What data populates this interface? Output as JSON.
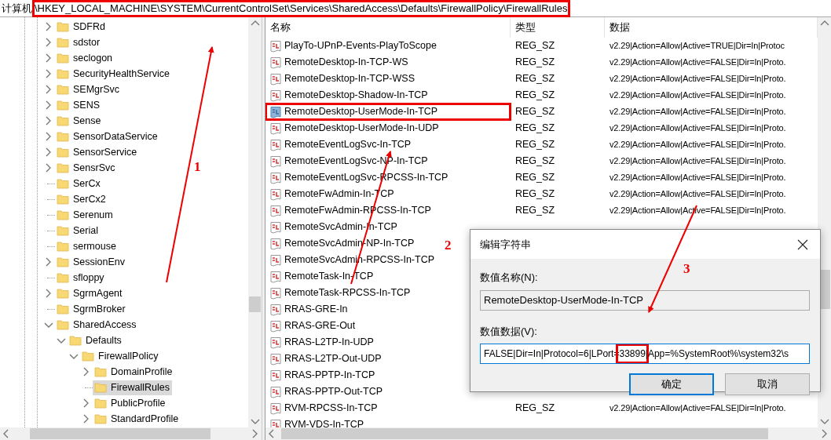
{
  "address_bar": {
    "label": "计算机",
    "path": "\\HKEY_LOCAL_MACHINE\\SYSTEM\\CurrentControlSet\\Services\\SharedAccess\\Defaults\\FirewallPolicy\\FirewallRules",
    "highlighted": true
  },
  "tree": {
    "items": [
      {
        "label": "SDFRd",
        "expandable": true,
        "expanded": false,
        "selected": false
      },
      {
        "label": "sdstor",
        "expandable": true,
        "expanded": false,
        "selected": false
      },
      {
        "label": "seclogon",
        "expandable": true,
        "expanded": false,
        "selected": false
      },
      {
        "label": "SecurityHealthService",
        "expandable": true,
        "expanded": false,
        "selected": false
      },
      {
        "label": "SEMgrSvc",
        "expandable": true,
        "expanded": false,
        "selected": false
      },
      {
        "label": "SENS",
        "expandable": true,
        "expanded": false,
        "selected": false
      },
      {
        "label": "Sense",
        "expandable": true,
        "expanded": false,
        "selected": false
      },
      {
        "label": "SensorDataService",
        "expandable": true,
        "expanded": false,
        "selected": false
      },
      {
        "label": "SensorService",
        "expandable": true,
        "expanded": false,
        "selected": false
      },
      {
        "label": "SensrSvc",
        "expandable": true,
        "expanded": false,
        "selected": false
      },
      {
        "label": "SerCx",
        "expandable": false,
        "selected": false
      },
      {
        "label": "SerCx2",
        "expandable": false,
        "selected": false
      },
      {
        "label": "Serenum",
        "expandable": false,
        "selected": false
      },
      {
        "label": "Serial",
        "expandable": false,
        "selected": false
      },
      {
        "label": "sermouse",
        "expandable": false,
        "selected": false
      },
      {
        "label": "SessionEnv",
        "expandable": true,
        "expanded": false,
        "selected": false
      },
      {
        "label": "sfloppy",
        "expandable": false,
        "selected": false
      },
      {
        "label": "SgrmAgent",
        "expandable": true,
        "expanded": false,
        "selected": false
      },
      {
        "label": "SgrmBroker",
        "expandable": false,
        "selected": false
      },
      {
        "label": "SharedAccess",
        "expandable": true,
        "expanded": true,
        "selected": false,
        "children": [
          {
            "label": "Defaults",
            "expandable": true,
            "expanded": true,
            "selected": false,
            "children": [
              {
                "label": "FirewallPolicy",
                "expandable": true,
                "expanded": true,
                "selected": false,
                "children": [
                  {
                    "label": "DomainProfile",
                    "expandable": true,
                    "expanded": false,
                    "selected": false
                  },
                  {
                    "label": "FirewallRules",
                    "expandable": false,
                    "selected": true
                  },
                  {
                    "label": "PublicProfile",
                    "expandable": true,
                    "expanded": false,
                    "selected": false
                  },
                  {
                    "label": "StandardProfile",
                    "expandable": true,
                    "expanded": false,
                    "selected": false
                  }
                ]
              }
            ]
          }
        ]
      }
    ]
  },
  "list": {
    "columns": [
      "名称",
      "类型",
      "数据"
    ],
    "rows": [
      {
        "name": "PlayTo-UPnP-Events-PlayToScope",
        "type": "REG_SZ",
        "data": "v2.29|Action=Allow|Active=TRUE|Dir=In|Protoc",
        "selected": false,
        "highlighted": false
      },
      {
        "name": "RemoteDesktop-In-TCP-WS",
        "type": "REG_SZ",
        "data": "v2.29|Action=Allow|Active=FALSE|Dir=In|Proto.",
        "selected": false,
        "highlighted": false
      },
      {
        "name": "RemoteDesktop-In-TCP-WSS",
        "type": "REG_SZ",
        "data": "v2.29|Action=Allow|Active=FALSE|Dir=In|Proto.",
        "selected": false,
        "highlighted": false
      },
      {
        "name": "RemoteDesktop-Shadow-In-TCP",
        "type": "REG_SZ",
        "data": "v2.29|Action=Allow|Active=FALSE|Dir=In|Proto.",
        "selected": false,
        "highlighted": false
      },
      {
        "name": "RemoteDesktop-UserMode-In-TCP",
        "type": "REG_SZ",
        "data": "v2.29|Action=Allow|Active=FALSE|Dir=In|Proto.",
        "selected": true,
        "highlighted": true
      },
      {
        "name": "RemoteDesktop-UserMode-In-UDP",
        "type": "REG_SZ",
        "data": "v2.29|Action=Allow|Active=FALSE|Dir=In|Proto.",
        "selected": false,
        "highlighted": false
      },
      {
        "name": "RemoteEventLogSvc-In-TCP",
        "type": "REG_SZ",
        "data": "v2.29|Action=Allow|Active=FALSE|Dir=In|Proto.",
        "selected": false,
        "highlighted": false
      },
      {
        "name": "RemoteEventLogSvc-NP-In-TCP",
        "type": "REG_SZ",
        "data": "v2.29|Action=Allow|Active=FALSE|Dir=In|Proto.",
        "selected": false,
        "highlighted": false
      },
      {
        "name": "RemoteEventLogSvc-RPCSS-In-TCP",
        "type": "REG_SZ",
        "data": "v2.29|Action=Allow|Active=FALSE|Dir=In|Proto.",
        "selected": false,
        "highlighted": false
      },
      {
        "name": "RemoteFwAdmin-In-TCP",
        "type": "REG_SZ",
        "data": "v2.29|Action=Allow|Active=FALSE|Dir=In|Proto.",
        "selected": false,
        "highlighted": false
      },
      {
        "name": "RemoteFwAdmin-RPCSS-In-TCP",
        "type": "REG_SZ",
        "data": "v2.29|Action=Allow|Active=FALSE|Dir=In|Proto.",
        "selected": false,
        "highlighted": false
      },
      {
        "name": "RemoteSvcAdmin-In-TCP",
        "selected": false,
        "highlighted": false
      },
      {
        "name": "RemoteSvcAdmin-NP-In-TCP",
        "selected": false,
        "highlighted": false
      },
      {
        "name": "RemoteSvcAdmin-RPCSS-In-TCP",
        "selected": false,
        "highlighted": false
      },
      {
        "name": "RemoteTask-In-TCP",
        "selected": false,
        "highlighted": false
      },
      {
        "name": "RemoteTask-RPCSS-In-TCP",
        "selected": false,
        "highlighted": false
      },
      {
        "name": "RRAS-GRE-In",
        "selected": false,
        "highlighted": false
      },
      {
        "name": "RRAS-GRE-Out",
        "selected": false,
        "highlighted": false
      },
      {
        "name": "RRAS-L2TP-In-UDP",
        "selected": false,
        "highlighted": false
      },
      {
        "name": "RRAS-L2TP-Out-UDP",
        "selected": false,
        "highlighted": false
      },
      {
        "name": "RRAS-PPTP-In-TCP",
        "selected": false,
        "highlighted": false
      },
      {
        "name": "RRAS-PPTP-Out-TCP",
        "selected": false,
        "highlighted": false
      },
      {
        "name": "RVM-RPCSS-In-TCP",
        "type": "REG_SZ",
        "data": "v2.29|Action=Allow|Active=FALSE|Dir=In|Proto.",
        "selected": false,
        "highlighted": false
      },
      {
        "name": "RVM-VDS-In-TCP",
        "selected": false,
        "highlighted": false
      }
    ]
  },
  "dialog": {
    "title": "编辑字符串",
    "name_label": "数值名称(N):",
    "name_value": "RemoteDesktop-UserMode-In-TCP",
    "data_label": "数值数据(V):",
    "data_parts": [
      {
        "text": "FALSE|Dir=In|Protocol=6|LPort=",
        "highlighted": false
      },
      {
        "text": "33899",
        "highlighted": true
      },
      {
        "text": "|App=%SystemRoot%\\system32\\s",
        "highlighted": false
      }
    ],
    "buttons": [
      {
        "label": "确定",
        "default": true
      },
      {
        "label": "取消",
        "default": false
      }
    ]
  },
  "annotations": [
    {
      "label": "1"
    },
    {
      "label": "2"
    },
    {
      "label": "3"
    }
  ]
}
